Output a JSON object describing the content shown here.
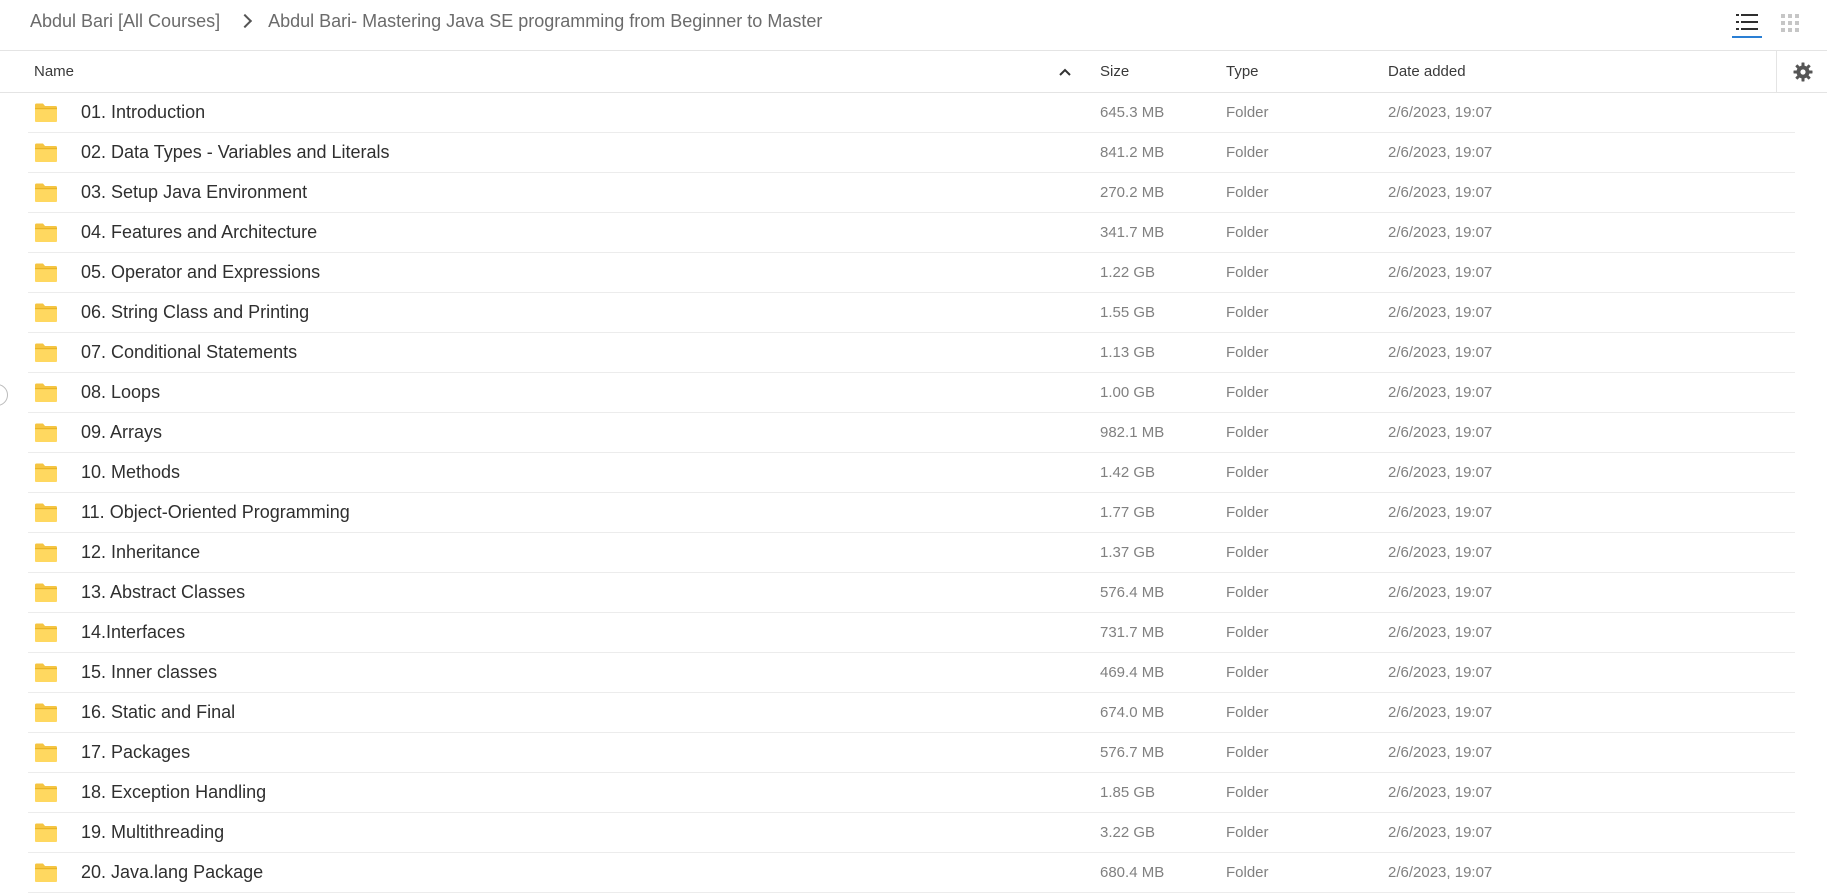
{
  "breadcrumb": {
    "parent": "Abdul Bari [All Courses]",
    "current": "Abdul Bari- Mastering Java SE programming from Beginner to Master"
  },
  "view": {
    "list_icon": "list-view-icon",
    "grid_icon": "grid-view-icon",
    "active": "list"
  },
  "columns": {
    "name": "Name",
    "size": "Size",
    "type": "Type",
    "date": "Date added",
    "sort": "ascending"
  },
  "colors": {
    "folder": "#f5c542",
    "active_view": "#2a7fd4"
  },
  "rows": [
    {
      "name": "01. Introduction",
      "size": "645.3 MB",
      "type": "Folder",
      "date": "2/6/2023, 19:07"
    },
    {
      "name": "02. Data Types - Variables and Literals",
      "size": "841.2 MB",
      "type": "Folder",
      "date": "2/6/2023, 19:07"
    },
    {
      "name": "03. Setup Java Environment",
      "size": "270.2 MB",
      "type": "Folder",
      "date": "2/6/2023, 19:07"
    },
    {
      "name": "04. Features and Architecture",
      "size": "341.7 MB",
      "type": "Folder",
      "date": "2/6/2023, 19:07"
    },
    {
      "name": "05. Operator and Expressions",
      "size": "1.22 GB",
      "type": "Folder",
      "date": "2/6/2023, 19:07"
    },
    {
      "name": "06. String Class and Printing",
      "size": "1.55 GB",
      "type": "Folder",
      "date": "2/6/2023, 19:07"
    },
    {
      "name": "07. Conditional Statements",
      "size": "1.13 GB",
      "type": "Folder",
      "date": "2/6/2023, 19:07"
    },
    {
      "name": "08. Loops",
      "size": "1.00 GB",
      "type": "Folder",
      "date": "2/6/2023, 19:07"
    },
    {
      "name": "09. Arrays",
      "size": "982.1 MB",
      "type": "Folder",
      "date": "2/6/2023, 19:07"
    },
    {
      "name": "10. Methods",
      "size": "1.42 GB",
      "type": "Folder",
      "date": "2/6/2023, 19:07"
    },
    {
      "name": "11. Object-Oriented Programming",
      "size": "1.77 GB",
      "type": "Folder",
      "date": "2/6/2023, 19:07"
    },
    {
      "name": "12. Inheritance",
      "size": "1.37 GB",
      "type": "Folder",
      "date": "2/6/2023, 19:07"
    },
    {
      "name": "13. Abstract Classes",
      "size": "576.4 MB",
      "type": "Folder",
      "date": "2/6/2023, 19:07"
    },
    {
      "name": "14.Interfaces",
      "size": "731.7 MB",
      "type": "Folder",
      "date": "2/6/2023, 19:07"
    },
    {
      "name": "15. Inner classes",
      "size": "469.4 MB",
      "type": "Folder",
      "date": "2/6/2023, 19:07"
    },
    {
      "name": "16. Static and Final",
      "size": "674.0 MB",
      "type": "Folder",
      "date": "2/6/2023, 19:07"
    },
    {
      "name": "17. Packages",
      "size": "576.7 MB",
      "type": "Folder",
      "date": "2/6/2023, 19:07"
    },
    {
      "name": "18. Exception Handling",
      "size": "1.85 GB",
      "type": "Folder",
      "date": "2/6/2023, 19:07"
    },
    {
      "name": "19. Multithreading",
      "size": "3.22 GB",
      "type": "Folder",
      "date": "2/6/2023, 19:07"
    },
    {
      "name": "20. Java.lang Package",
      "size": "680.4 MB",
      "type": "Folder",
      "date": "2/6/2023, 19:07"
    }
  ]
}
